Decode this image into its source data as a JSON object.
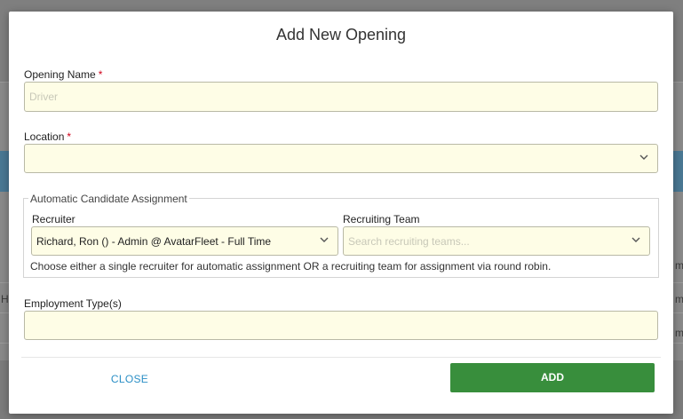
{
  "background": {
    "fragments": [
      "H",
      "m",
      "m",
      "m"
    ]
  },
  "dialog": {
    "title": "Add New Opening",
    "opening_name": {
      "label": "Opening Name",
      "required_mark": "*",
      "value": "",
      "placeholder": "Driver"
    },
    "location": {
      "label": "Location",
      "required_mark": "*",
      "value": ""
    },
    "assignment": {
      "legend": "Automatic Candidate Assignment",
      "recruiter": {
        "label": "Recruiter",
        "value": "Richard, Ron () - Admin @ AvatarFleet - Full Time"
      },
      "recruiting_team": {
        "label": "Recruiting Team",
        "placeholder": "Search recruiting teams..."
      },
      "hint": "Choose either a single recruiter for automatic assignment OR a recruiting team for assignment via round robin."
    },
    "employment_types": {
      "label": "Employment Type(s)",
      "value": ""
    },
    "close_label": "CLOSE",
    "add_label": "ADD"
  },
  "colors": {
    "field_bg": "#fefde6",
    "required": "#d0021b",
    "link": "#2b8fc6",
    "primary": "#388e3c"
  }
}
